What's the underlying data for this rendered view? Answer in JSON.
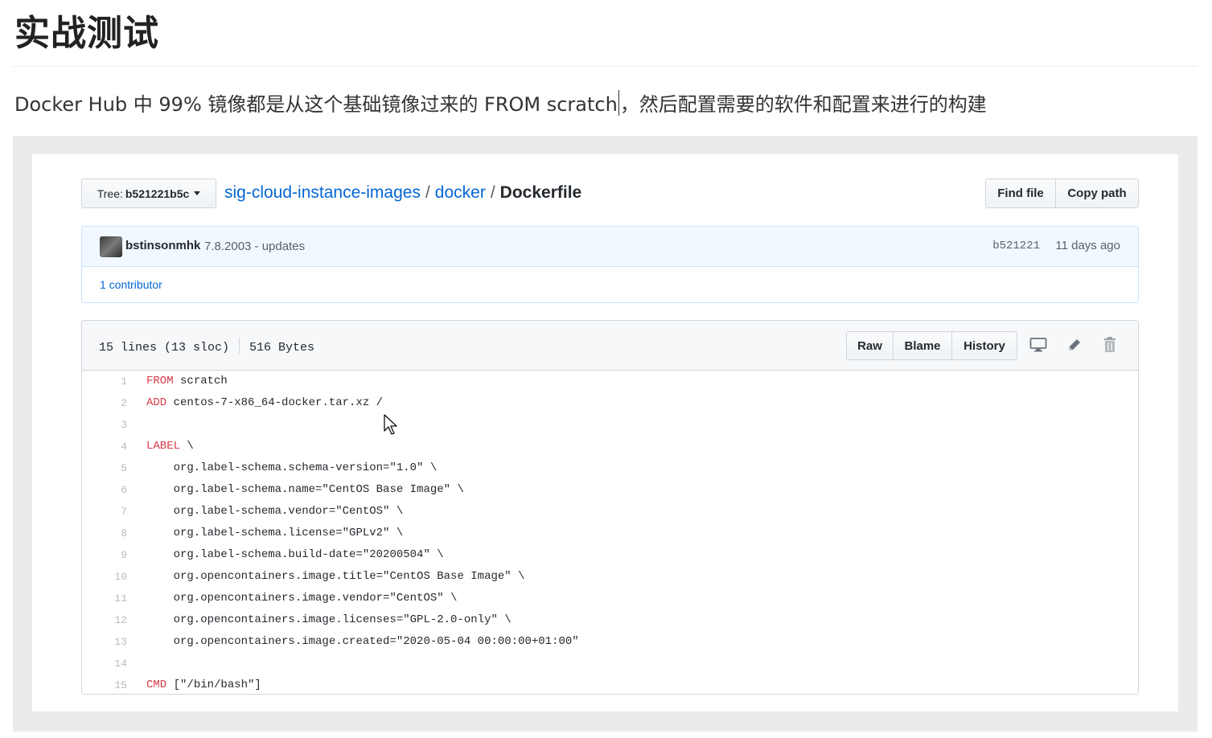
{
  "page": {
    "heading": "实战测试",
    "intro_before_caret": "Docker Hub 中 99% 镜像都是从这个基础镜像过来的 FROM scratch",
    "intro_after_caret": "，然后配置需要的软件和配置来进行的构建"
  },
  "github": {
    "tree_label": "Tree:",
    "tree_ref": "b521221b5c",
    "breadcrumb": {
      "repo": "sig-cloud-instance-images",
      "sep1": "/",
      "folder": "docker",
      "sep2": "/",
      "file": "Dockerfile"
    },
    "buttons": {
      "find_file": "Find file",
      "copy_path": "Copy path"
    },
    "commit": {
      "author": "bstinsonmhk",
      "message": "7.8.2003 - updates",
      "sha": "b521221",
      "time": "11 days ago",
      "contributors": "1 contributor"
    },
    "file": {
      "lines": "15 lines (13 sloc)",
      "size": "516 Bytes",
      "actions": {
        "raw": "Raw",
        "blame": "Blame",
        "history": "History"
      },
      "icons": [
        "desktop-icon",
        "pencil-icon",
        "trash-icon"
      ]
    },
    "code": [
      {
        "n": "1",
        "kw": "FROM",
        "rest": " scratch"
      },
      {
        "n": "2",
        "kw": "ADD",
        "rest": " centos-7-x86_64-docker.tar.xz /"
      },
      {
        "n": "3",
        "kw": "",
        "rest": ""
      },
      {
        "n": "4",
        "kw": "LABEL",
        "rest": " \\"
      },
      {
        "n": "5",
        "kw": "",
        "rest": "    org.label-schema.schema-version=\"1.0\" \\"
      },
      {
        "n": "6",
        "kw": "",
        "rest": "    org.label-schema.name=\"CentOS Base Image\" \\"
      },
      {
        "n": "7",
        "kw": "",
        "rest": "    org.label-schema.vendor=\"CentOS\" \\"
      },
      {
        "n": "8",
        "kw": "",
        "rest": "    org.label-schema.license=\"GPLv2\" \\"
      },
      {
        "n": "9",
        "kw": "",
        "rest": "    org.label-schema.build-date=\"20200504\" \\"
      },
      {
        "n": "10",
        "kw": "",
        "rest": "    org.opencontainers.image.title=\"CentOS Base Image\" \\"
      },
      {
        "n": "11",
        "kw": "",
        "rest": "    org.opencontainers.image.vendor=\"CentOS\" \\"
      },
      {
        "n": "12",
        "kw": "",
        "rest": "    org.opencontainers.image.licenses=\"GPL-2.0-only\" \\"
      },
      {
        "n": "13",
        "kw": "",
        "rest": "    org.opencontainers.image.created=\"2020-05-04 00:00:00+01:00\""
      },
      {
        "n": "14",
        "kw": "",
        "rest": ""
      },
      {
        "n": "15",
        "kw": "CMD",
        "rest": " [\"/bin/bash\"]"
      }
    ]
  }
}
